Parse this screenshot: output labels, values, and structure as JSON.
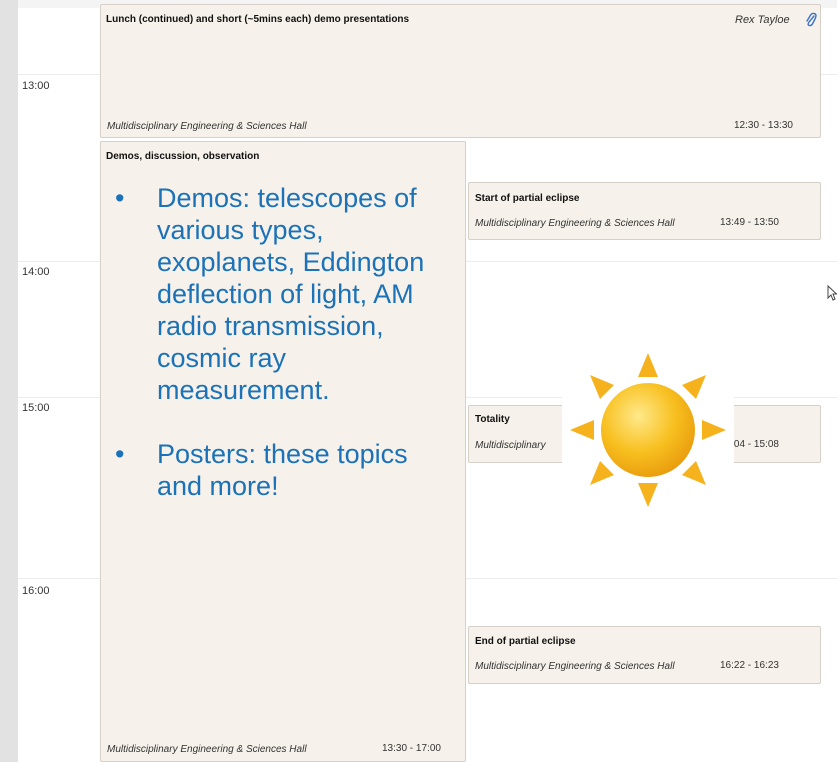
{
  "time_labels": [
    "13:00",
    "14:00",
    "15:00",
    "16:00"
  ],
  "events": {
    "lunch": {
      "title": "Lunch (continued) and short (~5mins each) demo presentations",
      "speaker": "Rex Tayloe",
      "location": "Multidisciplinary Engineering & Sciences Hall",
      "time": "12:30 - 13:30",
      "icon": "paperclip-icon"
    },
    "demos": {
      "title": "Demos, discussion, observation",
      "bullets": [
        "Demos: telescopes of various types, exoplanets, Eddington deflection of light,  AM radio transmission, cosmic ray measurement.",
        "Posters: these topics and more!"
      ],
      "location": "Multidisciplinary Engineering & Sciences Hall",
      "time": "13:30 - 17:00"
    },
    "partial_start": {
      "title": "Start of partial eclipse",
      "location": "Multidisciplinary Engineering & Sciences Hall",
      "time": "13:49 - 13:50"
    },
    "totality": {
      "title": "Totality",
      "location": "Multidisciplinary",
      "time": "15:04 - 15:08"
    },
    "partial_end": {
      "title": "End of partial eclipse",
      "location": "Multidisciplinary Engineering & Sciences Hall",
      "time": "16:22 - 16:23"
    }
  },
  "colors": {
    "event_bg": "#f6f1ea",
    "bullet_text": "#1b72b8",
    "sun": "#f5b21a"
  },
  "icons": [
    "paperclip-icon",
    "sun-icon",
    "mouse-cursor-icon"
  ]
}
